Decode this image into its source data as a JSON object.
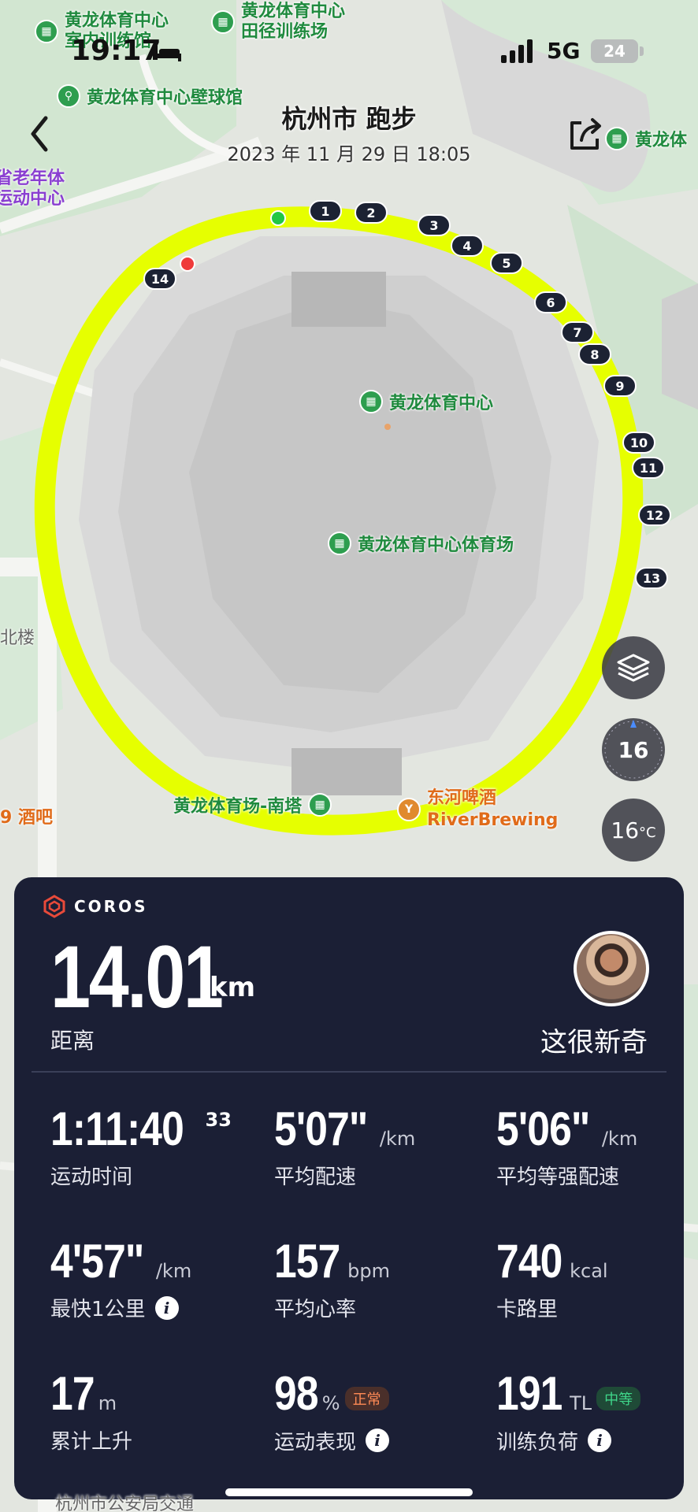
{
  "status_bar": {
    "time": "19:17",
    "network": "5G",
    "battery": "24"
  },
  "header": {
    "title": "杭州市 跑步",
    "subtitle": "2023 年 11 月 29 日 18:05"
  },
  "map": {
    "pois": [
      "黄龙体育中心\n室内训练馆",
      "黄龙体育中心\n田径训练场",
      "黄龙体育中心壁球馆",
      "黄龙体",
      "省老年体\n运动中心",
      "黄龙体育中心",
      "黄龙体育中心体育场",
      "黄龙体育场-南塔",
      "东河啤酒\nRiverBrewing",
      "9 酒吧",
      "北楼",
      "杭州市公安局交通"
    ],
    "km_markers": [
      "1",
      "2",
      "3",
      "4",
      "5",
      "6",
      "7",
      "8",
      "9",
      "10",
      "11",
      "12",
      "13",
      "14"
    ],
    "route_color": "#e6ff00",
    "start_color": "#22c744",
    "end_color": "#ef3b3b"
  },
  "controls": {
    "compass": "16",
    "temperature": "16",
    "temperature_unit": "°C"
  },
  "card": {
    "brand": "COROS",
    "distance": {
      "value": "14.01",
      "unit": "km",
      "label": "距离"
    },
    "user": {
      "name": "这很新奇"
    },
    "stats": [
      {
        "value": "1:11:40",
        "sup": "33",
        "unit": "",
        "label": "运动时间"
      },
      {
        "value": "5'07\"",
        "unit": "/km",
        "label": "平均配速"
      },
      {
        "value": "5'06\"",
        "unit": "/km",
        "label": "平均等强配速"
      },
      {
        "value": "4'57\"",
        "unit": "/km",
        "label": "最快1公里"
      },
      {
        "value": "157",
        "unit": "bpm",
        "label": "平均心率"
      },
      {
        "value": "740",
        "unit": "kcal",
        "label": "卡路里"
      },
      {
        "value": "17",
        "unit": "m",
        "label": "累计上升"
      },
      {
        "value": "98",
        "unit": "%",
        "badge": "正常",
        "label": "运动表现"
      },
      {
        "value": "191",
        "unit": "TL",
        "badge": "中等",
        "label": "训练负荷"
      }
    ]
  }
}
